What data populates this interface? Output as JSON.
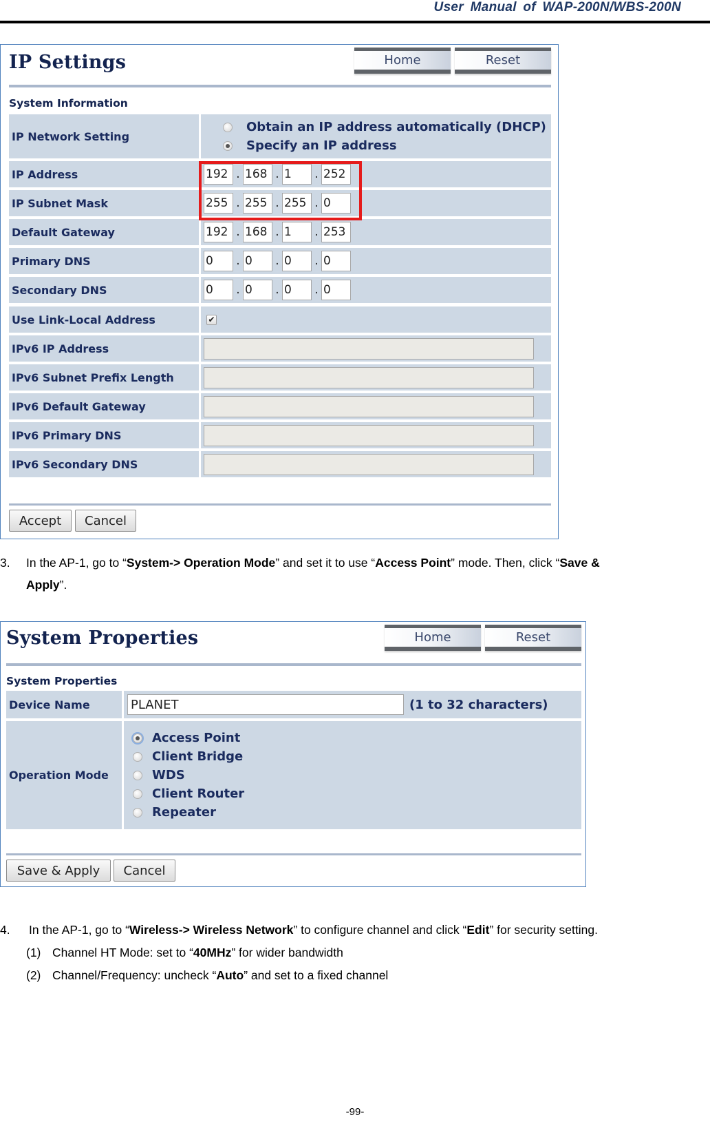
{
  "header": {
    "title": "User  Manual  of  WAP-200N/WBS-200N"
  },
  "ip_settings": {
    "title": "IP Settings",
    "home_label": "Home",
    "reset_label": "Reset",
    "section_label": "System Information",
    "network_setting": {
      "label": "IP Network Setting",
      "options": [
        {
          "label": "Obtain an IP address automatically (DHCP)",
          "selected": false
        },
        {
          "label": "Specify an IP address",
          "selected": true
        }
      ]
    },
    "ipv4_rows": [
      {
        "label": "IP Address",
        "octets": [
          "192",
          "168",
          "1",
          "252"
        ],
        "highlighted": true
      },
      {
        "label": "IP Subnet Mask",
        "octets": [
          "255",
          "255",
          "255",
          "0"
        ],
        "highlighted": true
      },
      {
        "label": "Default Gateway",
        "octets": [
          "192",
          "168",
          "1",
          "253"
        ],
        "highlighted": false
      },
      {
        "label": "Primary DNS",
        "octets": [
          "0",
          "0",
          "0",
          "0"
        ],
        "highlighted": false
      },
      {
        "label": "Secondary DNS",
        "octets": [
          "0",
          "0",
          "0",
          "0"
        ],
        "highlighted": false
      }
    ],
    "link_local": {
      "label": "Use Link-Local Address",
      "checked": true,
      "check_glyph": "✔"
    },
    "ipv6_rows": [
      {
        "label": "IPv6 IP Address",
        "value": ""
      },
      {
        "label": "IPv6 Subnet Prefix Length",
        "value": ""
      },
      {
        "label": "IPv6 Default Gateway",
        "value": ""
      },
      {
        "label": "IPv6 Primary DNS",
        "value": ""
      },
      {
        "label": "IPv6 Secondary DNS",
        "value": ""
      }
    ],
    "accept_label": "Accept",
    "cancel_label": "Cancel",
    "highlight_color": "#e51b1b"
  },
  "step3": {
    "number": "3.",
    "parts": [
      {
        "text": "In the AP-1, go to “",
        "bold": false
      },
      {
        "text": "System-> Operation Mode",
        "bold": true
      },
      {
        "text": "” and set it to use “",
        "bold": false
      },
      {
        "text": "Access Point",
        "bold": true
      },
      {
        "text": "” mode. Then, click “",
        "bold": false
      },
      {
        "text": "Save &",
        "bold": true
      }
    ],
    "line2": [
      {
        "text": "Apply",
        "bold": true
      },
      {
        "text": "”.",
        "bold": false
      }
    ]
  },
  "system_properties": {
    "title": "System Properties",
    "home_label": "Home",
    "reset_label": "Reset",
    "section_label": "System Properties",
    "device_name": {
      "label": "Device Name",
      "value": "PLANET",
      "hint": "(1 to 32 characters)"
    },
    "operation_mode": {
      "label": "Operation Mode",
      "options": [
        {
          "label": "Access Point",
          "selected": true
        },
        {
          "label": "Client Bridge",
          "selected": false
        },
        {
          "label": "WDS",
          "selected": false
        },
        {
          "label": "Client Router",
          "selected": false
        },
        {
          "label": "Repeater",
          "selected": false
        }
      ]
    },
    "save_apply_label": "Save & Apply",
    "cancel_label": "Cancel"
  },
  "step4": {
    "number": "4.",
    "parts": [
      {
        "text": "In the AP-1, go to “",
        "bold": false
      },
      {
        "text": "Wireless-> Wireless Network",
        "bold": true
      },
      {
        "text": "” to configure channel and click “",
        "bold": false
      },
      {
        "text": "Edit",
        "bold": true
      },
      {
        "text": "” for security setting.",
        "bold": false
      }
    ],
    "substeps": [
      {
        "number": "(1)",
        "parts": [
          {
            "text": "Channel HT Mode: set to “",
            "bold": false
          },
          {
            "text": "40MHz",
            "bold": true
          },
          {
            "text": "” for wider bandwidth",
            "bold": false
          }
        ]
      },
      {
        "number": "(2)",
        "parts": [
          {
            "text": "Channel/Frequency: uncheck “",
            "bold": false
          },
          {
            "text": "Auto",
            "bold": true
          },
          {
            "text": "” and set to a fixed channel",
            "bold": false
          }
        ]
      }
    ]
  },
  "footer": {
    "page_number": "-99-"
  }
}
